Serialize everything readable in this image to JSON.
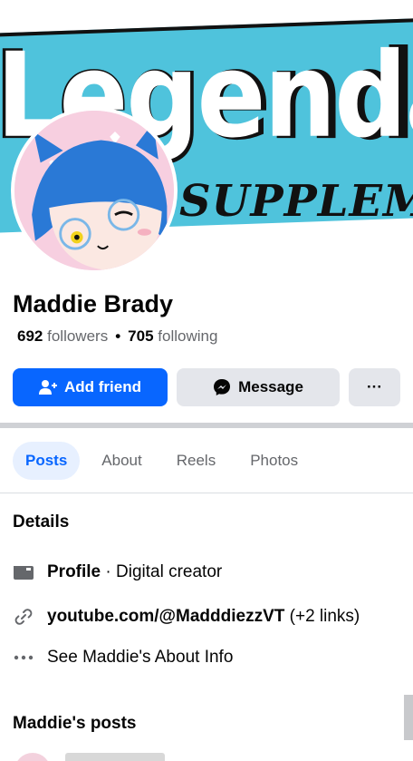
{
  "cover": {
    "title_text": "Legendar",
    "subtitle_text": "SUPPLEME",
    "brand_color": "#4fc3dc"
  },
  "profile": {
    "name": "Maddie Brady",
    "followers_count": "692",
    "followers_label": "followers",
    "following_count": "705",
    "following_label": "following"
  },
  "actions": {
    "add_friend_label": "Add friend",
    "message_label": "Message",
    "more_label": "···",
    "primary_color": "#0866ff"
  },
  "tabs": [
    {
      "label": "Posts",
      "active": true
    },
    {
      "label": "About",
      "active": false
    },
    {
      "label": "Reels",
      "active": false
    },
    {
      "label": "Photos",
      "active": false
    }
  ],
  "details": {
    "title": "Details",
    "profile_label": "Profile",
    "profile_sep": "·",
    "profile_value": "Digital creator",
    "link_text": "youtube.com/@MadddiezzVT",
    "link_extra": "(+2 links)",
    "about_link": "See Maddie's About Info"
  },
  "posts": {
    "title": "Maddie's posts"
  }
}
